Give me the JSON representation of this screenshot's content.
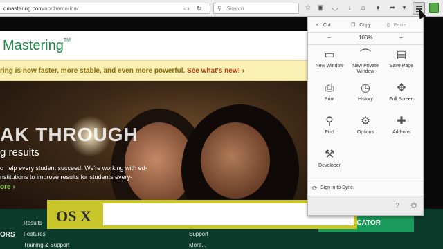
{
  "browser": {
    "url_host": "dmastering.com",
    "url_path": "/northamerica/",
    "search_placeholder": "Search"
  },
  "site": {
    "logo_text": "Mastering",
    "logo_tm": "TM",
    "banner_text": "ring is now faster, more stable, and even more powerful.",
    "banner_link": "See what's new! ›",
    "hero_title": "AK THROUGH",
    "hero_subtitle": "g results",
    "hero_line1": "o help every student succeed. We're working with ed-",
    "hero_line2": "nstitutions to improve results for students every-",
    "hero_more": "ore ›",
    "footer": {
      "col1_head": "ORS",
      "col2": [
        "Results",
        "Features",
        "Training & Support"
      ],
      "col3": [
        "Support",
        "More..."
      ],
      "educator_button": "UCATOR"
    }
  },
  "overlay": {
    "label": "OS X",
    "field_value": ""
  },
  "menu": {
    "edit": {
      "cut": "Cut",
      "copy": "Copy",
      "paste": "Paste"
    },
    "zoom": {
      "minus": "−",
      "level": "100%",
      "plus": "+"
    },
    "tiles": [
      {
        "label": "New Window",
        "icon": "window-icon",
        "glyph": "▭"
      },
      {
        "label": "New Private Window",
        "icon": "mask-icon",
        "glyph": "⌒"
      },
      {
        "label": "Save Page",
        "icon": "page-icon",
        "glyph": "▤"
      },
      {
        "label": "Print",
        "icon": "printer-icon",
        "glyph": "⎙"
      },
      {
        "label": "History",
        "icon": "clock-icon",
        "glyph": "◷"
      },
      {
        "label": "Full Screen",
        "icon": "fullscreen-icon",
        "glyph": "✥"
      },
      {
        "label": "Find",
        "icon": "magnifier-icon",
        "glyph": "⚲"
      },
      {
        "label": "Options",
        "icon": "gear-icon",
        "glyph": "⚙"
      },
      {
        "label": "Add-ons",
        "icon": "puzzle-icon",
        "glyph": "✚"
      },
      {
        "label": "Developer",
        "icon": "wrench-icon",
        "glyph": "⚒"
      }
    ],
    "sync": "Sign in to Sync"
  }
}
